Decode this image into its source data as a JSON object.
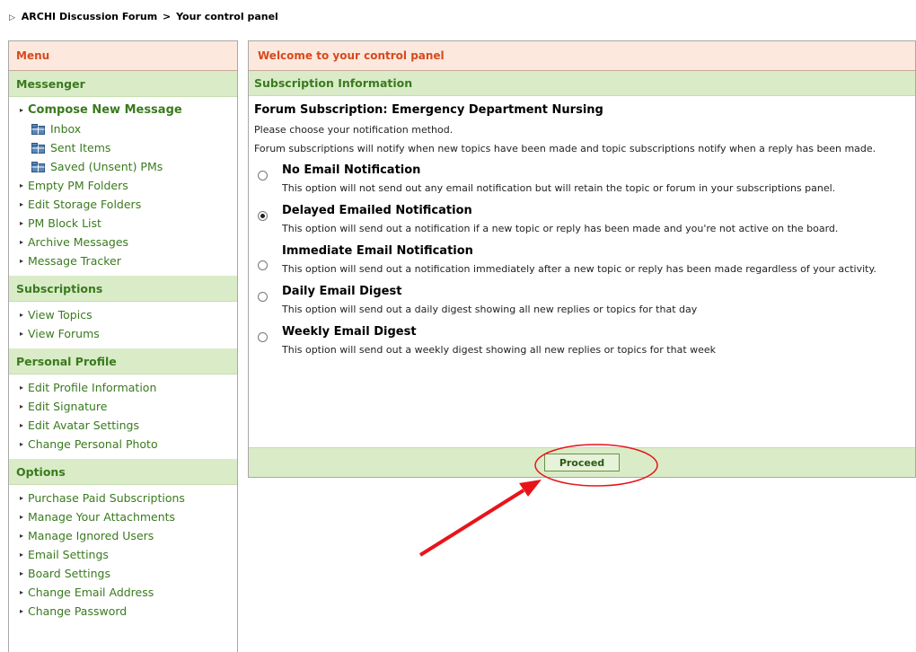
{
  "breadcrumb": {
    "forum": "ARCHI Discussion Forum",
    "separator": ">",
    "current": "Your control panel"
  },
  "sidebar": {
    "title": "Menu",
    "sections": [
      {
        "title": "Messenger",
        "items": [
          {
            "label": "Compose New Message"
          },
          {
            "label": "Inbox"
          },
          {
            "label": "Sent Items"
          },
          {
            "label": "Saved (Unsent) PMs"
          },
          {
            "label": "Empty PM Folders"
          },
          {
            "label": "Edit Storage Folders"
          },
          {
            "label": "PM Block List"
          },
          {
            "label": "Archive Messages"
          },
          {
            "label": "Message Tracker"
          }
        ]
      },
      {
        "title": "Subscriptions",
        "items": [
          {
            "label": "View Topics"
          },
          {
            "label": "View Forums"
          }
        ]
      },
      {
        "title": "Personal Profile",
        "items": [
          {
            "label": "Edit Profile Information"
          },
          {
            "label": "Edit Signature"
          },
          {
            "label": "Edit Avatar Settings"
          },
          {
            "label": "Change Personal Photo"
          }
        ]
      },
      {
        "title": "Options",
        "items": [
          {
            "label": "Purchase Paid Subscriptions"
          },
          {
            "label": "Manage Your Attachments"
          },
          {
            "label": "Manage Ignored Users"
          },
          {
            "label": "Email Settings"
          },
          {
            "label": "Board Settings"
          },
          {
            "label": "Change Email Address"
          },
          {
            "label": "Change Password"
          }
        ]
      }
    ]
  },
  "main": {
    "title": "Welcome to your control panel",
    "subheader": "Subscription Information",
    "forum_title": "Forum Subscription: Emergency Department Nursing",
    "instruction": "Please choose your notification method.",
    "description": "Forum subscriptions will notify when new topics have been made and topic subscriptions notify when a reply has been made.",
    "options": [
      {
        "title": "No Email Notification",
        "desc": "This option will not send out any email notification but will retain the topic or forum in your subscriptions panel.",
        "selected": false
      },
      {
        "title": "Delayed Emailed Notification",
        "desc": "This option will send out a notification if a new topic or reply has been made and you're not active on the board.",
        "selected": true
      },
      {
        "title": "Immediate Email Notification",
        "desc": "This option will send out a notification immediately after a new topic or reply has been made regardless of your activity.",
        "selected": false
      },
      {
        "title": "Daily Email Digest",
        "desc": "This option will send out a daily digest showing all new replies or topics for that day",
        "selected": false
      },
      {
        "title": "Weekly Email Digest",
        "desc": "This option will send out a weekly digest showing all new replies or topics for that week",
        "selected": false
      }
    ],
    "proceed_label": "Proceed"
  },
  "colors": {
    "header_bg": "#fde8de",
    "header_text": "#d64a1c",
    "section_bg": "#d9ecc7",
    "section_text": "#3a7a1e",
    "annotation": "#e8141a"
  },
  "icons": {
    "folder": "folder-icon",
    "bullet": "triangle-right-icon"
  }
}
